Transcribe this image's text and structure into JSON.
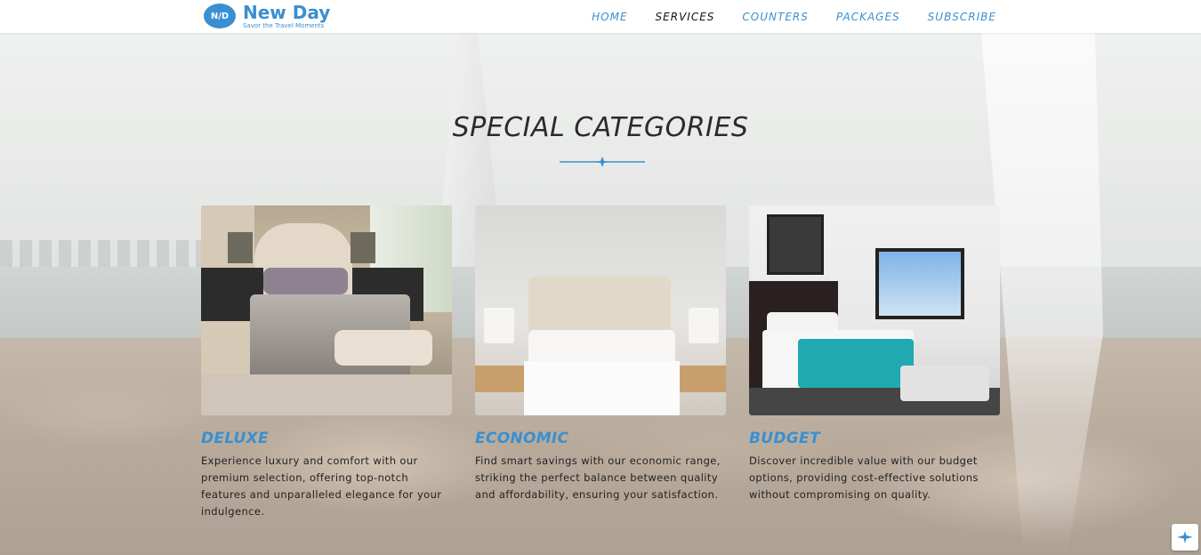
{
  "header": {
    "logo_badge": "N/D",
    "logo_name": "New Day",
    "logo_tagline": "Savor the Travel Moments",
    "nav": [
      {
        "label": "HOME",
        "active": false
      },
      {
        "label": "SERVICES",
        "active": true
      },
      {
        "label": "COUNTERS",
        "active": false
      },
      {
        "label": "PACKAGES",
        "active": false
      },
      {
        "label": "SUBSCRIBE",
        "active": false
      }
    ]
  },
  "section": {
    "title": "SPECIAL CATEGORIES",
    "divider_icon": "airplane-icon",
    "categories": [
      {
        "name": "DELUXE",
        "description": "Experience luxury and comfort with our premium selection, offering top-notch features and unparalleled elegance for your indulgence.",
        "image": "bedroom-deluxe-photo"
      },
      {
        "name": "ECONOMIC",
        "description": "Find smart savings with our economic range, striking the perfect balance between quality and affordability, ensuring your satisfaction.",
        "image": "bedroom-economic-photo"
      },
      {
        "name": "BUDGET",
        "description": "Discover incredible value with our budget options, providing cost-effective solutions without compromising on quality.",
        "image": "bedroom-budget-photo"
      }
    ]
  },
  "scroll_button_icon": "airplane-icon",
  "colors": {
    "accent": "#3a8fd0",
    "nav_active": "#111111",
    "title": "#2b2b2b"
  }
}
